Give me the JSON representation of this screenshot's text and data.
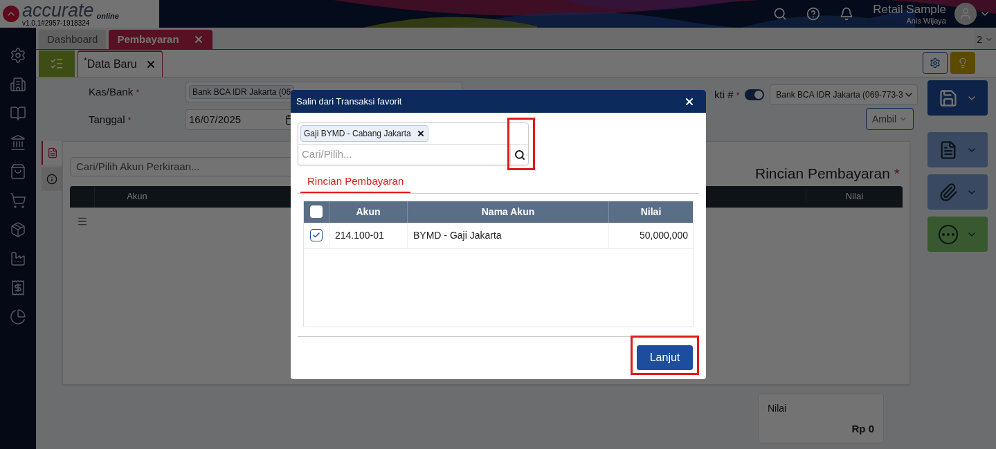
{
  "app": {
    "logo": "accurate",
    "logo_sub": "online",
    "version": "v1.0.1#2957-1918324",
    "company": "Retail Sample",
    "user": "Anis Wijaya",
    "tab_count": "2"
  },
  "tabs": [
    {
      "label": "Dashboard",
      "selected": false
    },
    {
      "label": "Pembayaran",
      "selected": true
    }
  ],
  "subtabs": [
    {
      "label": "$^{*}$Data Baru",
      "selected": true
    }
  ],
  "form": {
    "fields": [
      {
        "label": "Kas/Bank",
        "mark": "*",
        "value": "Bank BCA IDR Jakarta (06"
      },
      {
        "label": "Tanggal",
        "mark": "*",
        "value": "16/07/2025"
      }
    ],
    "no_bukti_label": "kti #",
    "no_bukti_mark": "*",
    "auto_number_on": true,
    "bank_select": "Bank BCA IDR Jakarta (069-773-3",
    "ambil": "Ambil"
  },
  "detail": {
    "search_placeholder": "Cari/Pilih Akun Perkiraan...",
    "title": "Rincian Pembayaran",
    "title_mark": "*",
    "columns": [
      "Akun",
      "Nilai"
    ]
  },
  "summary": {
    "label": "Nilai",
    "value": "Rp 0"
  },
  "modal": {
    "title": "Salin dari Transaksi favorit",
    "chip": "Gaji BYMD - Cabang Jakarta",
    "search_placeholder": "Cari/Pilih...",
    "tabs": [
      {
        "label": "Rincian Pembayaran",
        "selected": true
      }
    ],
    "columns": [
      "Akun",
      "Nama Akun",
      "Nilai"
    ],
    "all_checked": false,
    "rows": [
      {
        "checked": true,
        "akun": "214.100-01",
        "nama": "BYMD - Gaji Jakarta",
        "nilai": "50,000,000"
      }
    ],
    "button": "Lanjut"
  }
}
